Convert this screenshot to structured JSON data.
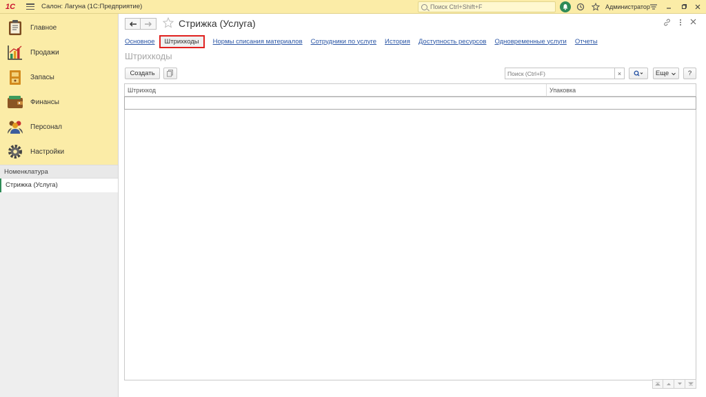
{
  "topbar": {
    "logo": "1С",
    "app_title": "Салон: Лагуна  (1С:Предприятие)",
    "search_placeholder": "Поиск Ctrl+Shift+F",
    "user": "Администратор"
  },
  "sidebar": {
    "sections": [
      {
        "label": "Главное",
        "icon": "clipboard-icon"
      },
      {
        "label": "Продажи",
        "icon": "sales-chart-icon"
      },
      {
        "label": "Запасы",
        "icon": "stock-icon"
      },
      {
        "label": "Финансы",
        "icon": "wallet-icon"
      },
      {
        "label": "Персонал",
        "icon": "staff-icon"
      },
      {
        "label": "Настройки",
        "icon": "gear-icon"
      }
    ],
    "nav_group": "Номенклатура",
    "open_window": "Стрижка (Услуга)"
  },
  "form": {
    "title": "Стрижка (Услуга)",
    "tabs": [
      {
        "label": "Основное"
      },
      {
        "label": "Штрихкоды"
      },
      {
        "label": "Нормы списания материалов"
      },
      {
        "label": "Сотрудники по услуге"
      },
      {
        "label": "История"
      },
      {
        "label": "Доступность ресурсов"
      },
      {
        "label": "Одновременные услуги"
      },
      {
        "label": "Отчеты"
      }
    ],
    "active_tab": "Штрихкоды",
    "section_title": "Штрихкоды",
    "toolbar": {
      "create_label": "Создать",
      "search_placeholder": "Поиск (Ctrl+F)",
      "clear_symbol": "×",
      "more_label": "Еще",
      "help_label": "?"
    },
    "table": {
      "columns": [
        "Штрихкод",
        "Упаковка"
      ],
      "rows": []
    }
  },
  "colors": {
    "accent_yellow": "#fbeca7",
    "link_blue": "#2a55a5",
    "highlight_red": "#e0201e",
    "notify_green": "#2e8b57"
  }
}
